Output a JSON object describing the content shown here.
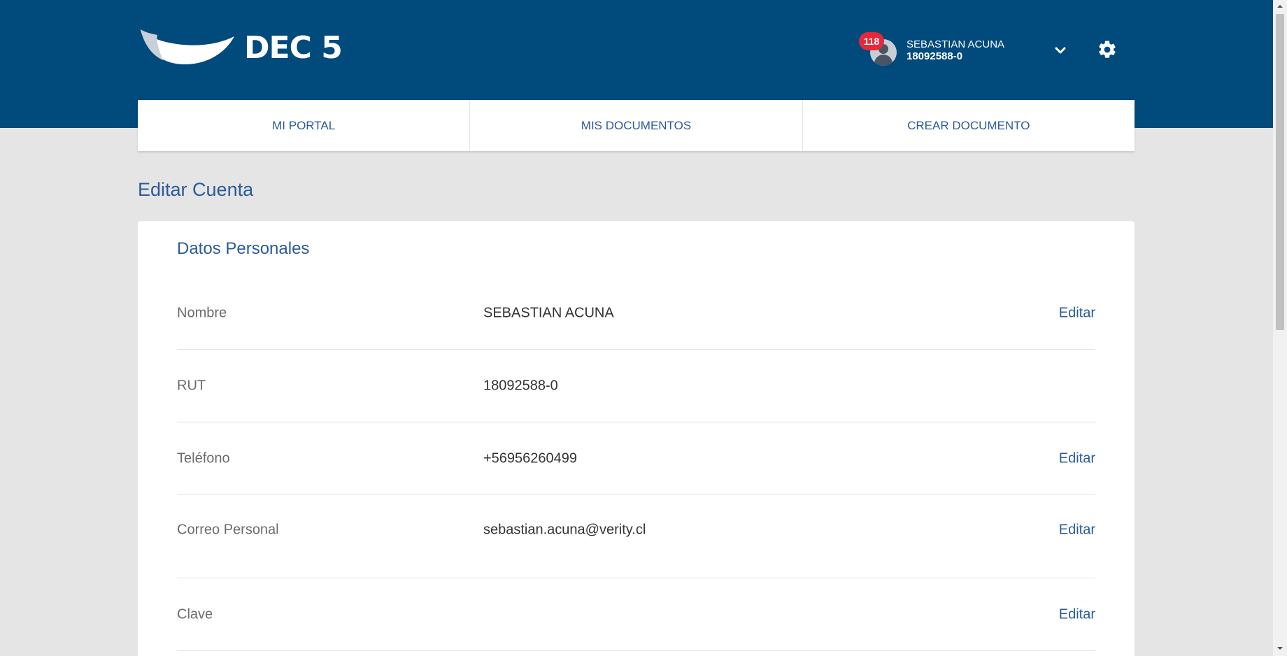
{
  "header": {
    "logo_text": "DEC 5",
    "notification_count": "118",
    "user_name": "SEBASTIAN ACUNA",
    "user_rut": "18092588-0"
  },
  "nav": {
    "tabs": [
      {
        "label": "MI PORTAL"
      },
      {
        "label": "MIS DOCUMENTOS"
      },
      {
        "label": "CREAR DOCUMENTO"
      }
    ]
  },
  "page": {
    "title": "Editar Cuenta"
  },
  "personal": {
    "title": "Datos Personales",
    "edit_label": "Editar",
    "rows": [
      {
        "label": "Nombre",
        "value": "SEBASTIAN ACUNA",
        "editable": true
      },
      {
        "label": "RUT",
        "value": "18092588-0",
        "editable": false
      },
      {
        "label": "Teléfono",
        "value": "+56956260499",
        "editable": true
      },
      {
        "label": "Correo Personal",
        "value": "sebastian.acuna@verity.cl",
        "editable": true
      },
      {
        "label": "Clave",
        "value": "",
        "editable": true
      }
    ]
  },
  "colors": {
    "header_bg": "#004a7c",
    "accent": "#2a5b98",
    "badge": "#e5283b",
    "page_bg": "#e5e5e5"
  },
  "icons": {
    "logo": "wave-logo-icon",
    "avatar": "user-avatar-icon",
    "dropdown": "chevron-down-icon",
    "settings": "gear-icon"
  }
}
